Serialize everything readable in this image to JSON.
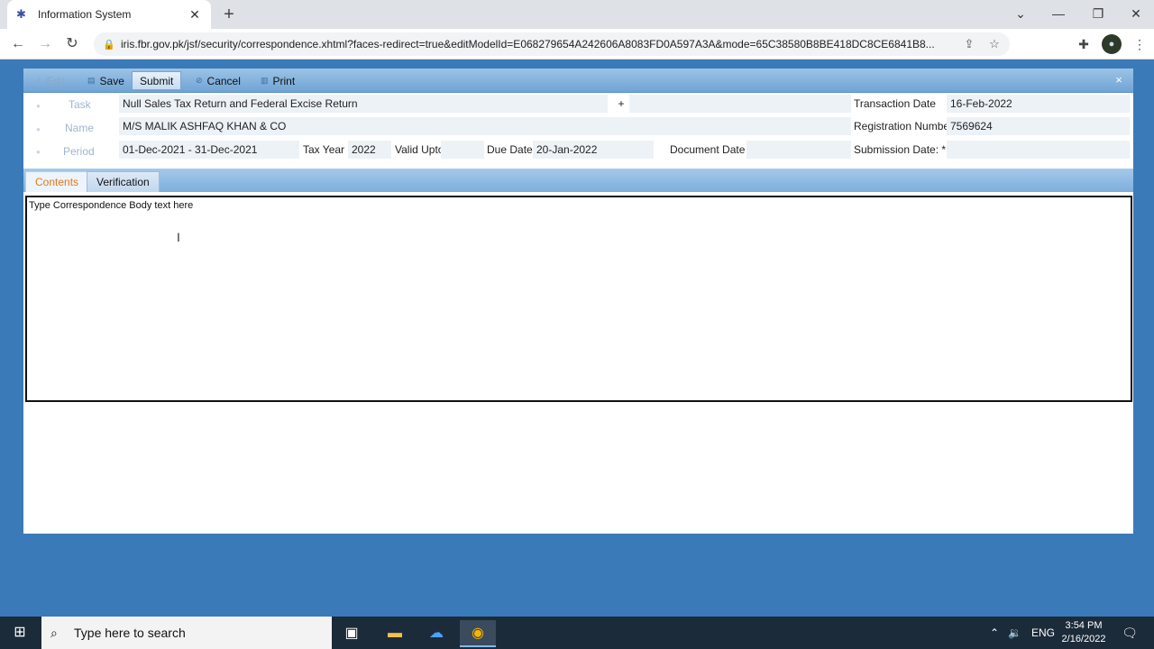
{
  "browser": {
    "tab_title": "Information System",
    "tab_close": "✕",
    "new_tab": "+",
    "url": "iris.fbr.gov.pk/jsf/security/correspondence.xhtml?faces-redirect=true&editModelId=E068279654A242606A8083FD0A597A3A&mode=65C38580B8BE418DC8CE6841B8..."
  },
  "app": {
    "toolbar": {
      "edit": "Edit",
      "save": "Save",
      "submit": "Submit",
      "cancel": "Cancel",
      "print": "Print",
      "close": "×"
    },
    "form": {
      "task_label": "Task",
      "task_value": "Null Sales Tax Return and Federal Excise Return",
      "task_add": "+",
      "name_label": "Name",
      "name_value": "M/S MALIK ASHFAQ KHAN & CO",
      "period_label": "Period",
      "period_value": "01-Dec-2021 - 31-Dec-2021",
      "tax_year_label": "Tax Year",
      "tax_year_value": "2022",
      "valid_upto_label": "Valid Upto",
      "due_date_label": "Due Date",
      "due_date_value": "20-Jan-2022",
      "document_date_label": "Document Date",
      "transaction_date_label": "Transaction Date",
      "transaction_date_value": "16-Feb-2022",
      "registration_number_label": "Registration Number",
      "registration_number_value": "7569624",
      "submission_date_label": "Submission Date: *"
    },
    "tabs": [
      {
        "label": "Contents"
      },
      {
        "label": "Verification"
      }
    ],
    "editor_text": "Type Correspondence Body text here"
  },
  "taskbar": {
    "search_placeholder": "Type here to search",
    "lang": "ENG",
    "time": "3:54 PM",
    "date": "2/16/2022"
  },
  "colors": {
    "app_background": "#3a7ab8",
    "active_tab_text": "#e07a1a"
  }
}
